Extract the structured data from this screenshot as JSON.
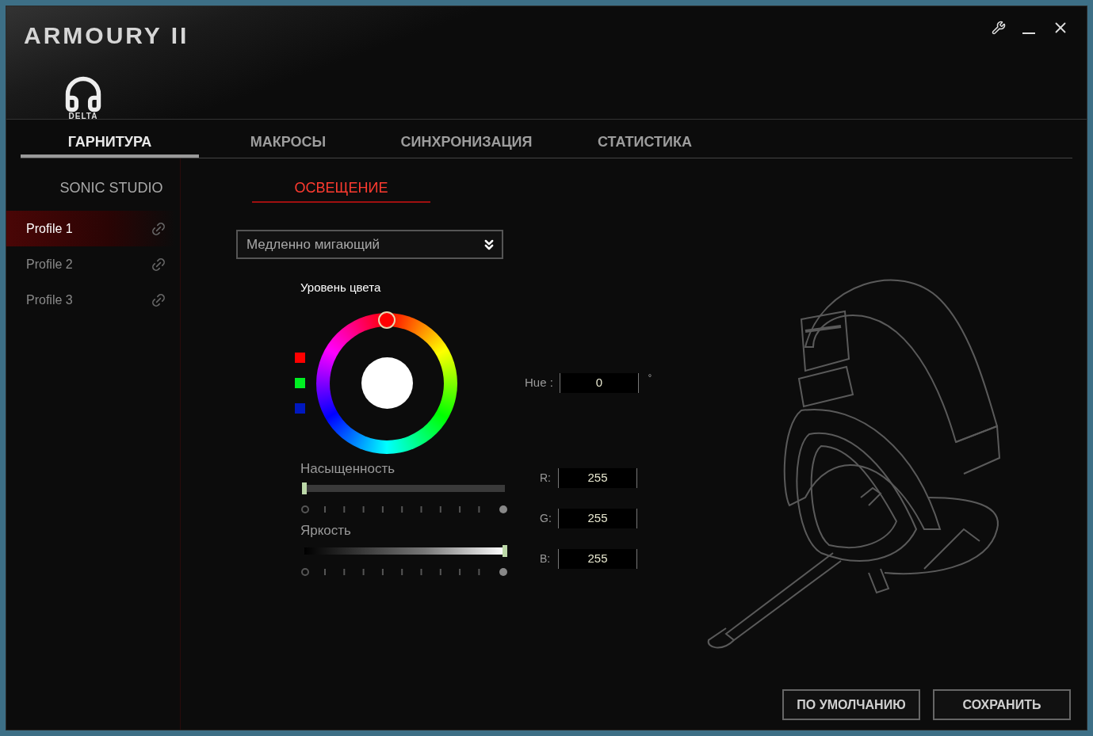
{
  "window": {
    "title": "ARMOURY II"
  },
  "device": {
    "label": "DELTA"
  },
  "tabs": [
    {
      "label": "ГАРНИТУРА",
      "selected": true
    },
    {
      "label": "МАКРОСЫ",
      "selected": false
    },
    {
      "label": "СИНХРОНИЗАЦИЯ",
      "selected": false
    },
    {
      "label": "СТАТИСТИКА",
      "selected": false
    }
  ],
  "subtabs": [
    {
      "label": "SONIC STUDIO",
      "selected": false
    },
    {
      "label": "ОСВЕЩЕНИЕ",
      "selected": true
    }
  ],
  "profiles": [
    {
      "label": "Profile 1",
      "selected": true
    },
    {
      "label": "Profile 2",
      "selected": false
    },
    {
      "label": "Profile 3",
      "selected": false
    }
  ],
  "lighting": {
    "effect": "Медленно мигающий",
    "color_level_label": "Уровень цвета",
    "swatches": [
      {
        "color": "#ff0000"
      },
      {
        "color": "#00ee22"
      },
      {
        "color": "#0018c0"
      }
    ],
    "hue_label": "Hue :",
    "hue": "0",
    "degree": "°",
    "saturation": {
      "label": "Насыщенность",
      "level": 0
    },
    "brightness": {
      "label": "Яркость",
      "level": 1
    },
    "rgb": [
      {
        "label": "R:",
        "value": "255"
      },
      {
        "label": "G:",
        "value": "255"
      },
      {
        "label": "B:",
        "value": "255"
      }
    ]
  },
  "buttons": [
    {
      "label": "ПО УМОЛЧАНИЮ"
    },
    {
      "label": "СОХРАНИТЬ"
    }
  ]
}
